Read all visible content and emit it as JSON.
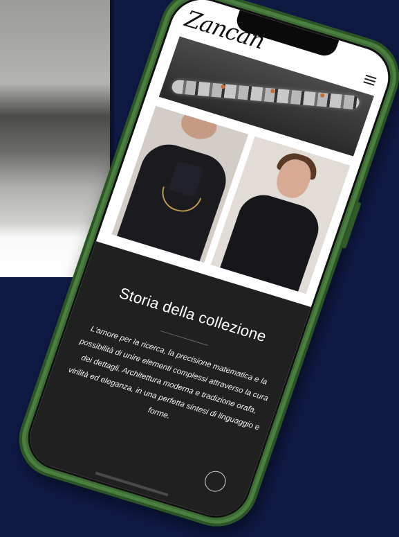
{
  "brand": {
    "logo_text": "Zancan"
  },
  "header": {
    "menu_icon": "hamburger-menu-icon"
  },
  "section": {
    "title": "Storia della collezione",
    "body": "L'amore per la ricerca, la precisione matematica e la possibilità di unire elementi complessi attraverso la cura dei dettagli. Architettura moderna e tradizione orafa, virilità ed eleganza, in una perfetta sintesi di linguaggio e forme."
  },
  "colors": {
    "background": "#0f1a45",
    "phone_frame": "#3c6b34",
    "dark_section": "#202020"
  }
}
